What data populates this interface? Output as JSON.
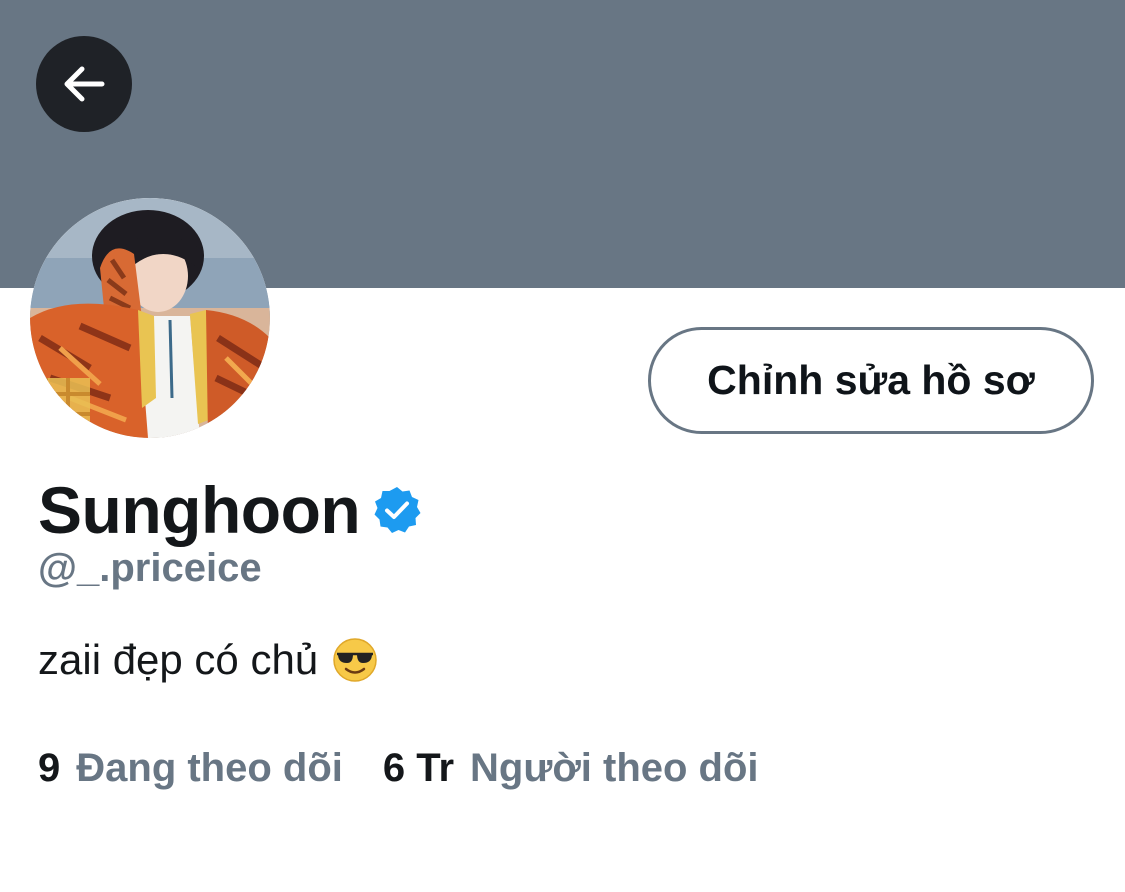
{
  "profile": {
    "display_name": "Sunghoon",
    "handle": "@_.priceice",
    "bio": "zaii đẹp có chủ",
    "bio_emoji": "smiling-face-with-sunglasses-icon",
    "verified": true
  },
  "actions": {
    "back_icon": "arrow-left-icon",
    "edit_profile_label": "Chỉnh sửa hồ sơ"
  },
  "stats": {
    "following_count": "9",
    "following_label": "Đang theo dõi",
    "followers_count": "6 Tr",
    "followers_label": "Người theo dõi"
  },
  "colors": {
    "banner": "#687684",
    "back_button_bg": "#1f2227",
    "text_primary": "#14171a",
    "text_secondary": "#687684",
    "verified_blue": "#1d9bf0",
    "button_border": "#687684"
  }
}
